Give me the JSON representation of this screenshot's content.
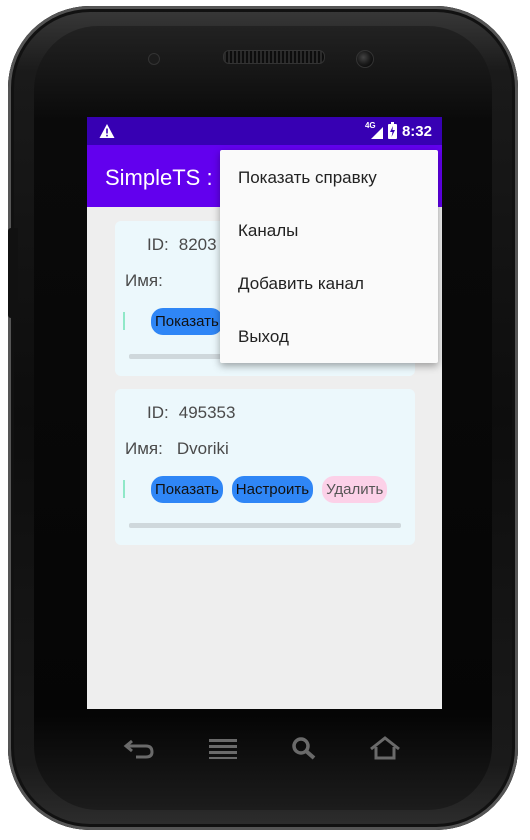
{
  "status_bar": {
    "time": "8:32",
    "network": "4G"
  },
  "app_bar": {
    "title": "SimpleTS : I"
  },
  "cards": [
    {
      "id_label": "ID:",
      "id_value": "8203",
      "name_label": "Имя:",
      "name_value": "",
      "show_label": "Показать"
    },
    {
      "id_label": "ID:",
      "id_value": "495353",
      "name_label": "Имя:",
      "name_value": "Dvoriki",
      "show_label": "Показать",
      "configure_label": "Настроить",
      "delete_label": "Удалить"
    }
  ],
  "menu": {
    "items": [
      {
        "label": "Показать справку"
      },
      {
        "label": "Каналы"
      },
      {
        "label": "Добавить канал"
      },
      {
        "label": "Выход"
      }
    ]
  },
  "nav_keys": [
    "back-icon",
    "menu-icon",
    "search-icon",
    "home-icon"
  ],
  "colors": {
    "status_bar": "#3700b3",
    "app_bar": "#6200ee",
    "button_blue": "#2f86f6",
    "button_pink": "#fcd1e8",
    "card": "#ecf8fc"
  }
}
